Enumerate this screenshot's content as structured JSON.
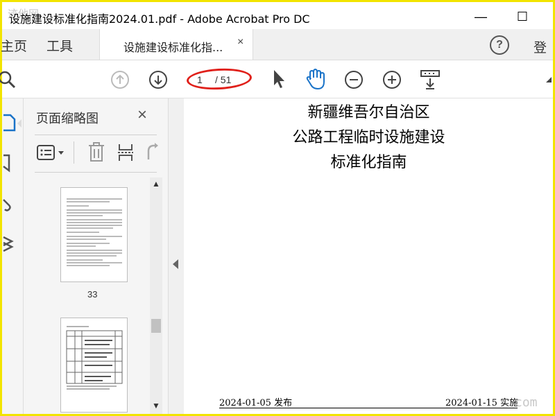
{
  "window": {
    "title": "设施建设标准化指南2024.01.pdf - Adobe Acrobat Pro DC",
    "minimize_icon": "minimize-icon",
    "maximize_icon": "maximize-icon"
  },
  "menu": {
    "home": "主页",
    "tools": "工具",
    "doc_tab_label": "设施建设标准化指...",
    "doc_tab_close": "×",
    "help": "?",
    "signin": "登录"
  },
  "toolbar": {
    "page_current": "1",
    "page_total": "/ 51",
    "icons": [
      "zoom-search-icon",
      "prev-page-icon",
      "next-page-icon",
      "select-cursor-icon",
      "hand-tool-icon",
      "zoom-out-icon",
      "zoom-in-icon",
      "fit-page-icon",
      "more-icon"
    ]
  },
  "nav_icons": [
    "page-thumbnails-icon",
    "bookmark-icon",
    "attachments-icon",
    "layers-icon"
  ],
  "thumb_panel": {
    "title": "页面缩略图",
    "close": "×",
    "tools": [
      "thumbnail-options-icon",
      "delete-page-icon",
      "extract-page-icon",
      "rotate-page-icon"
    ],
    "thumbs": [
      {
        "label": "33"
      },
      {
        "label": ""
      }
    ]
  },
  "document": {
    "lines": [
      "新疆维吾尔自治区",
      "公路工程临时设施建设",
      "标准化指南"
    ],
    "footer_left": "2024-01-05 发布",
    "footer_right": "2024-01-15 实施"
  },
  "watermark": {
    "logo": "迹他网",
    "text": "com"
  },
  "colors": {
    "frame": "#f2e400",
    "highlight": "#e0201a",
    "hand_tool": "#1a73c8"
  }
}
